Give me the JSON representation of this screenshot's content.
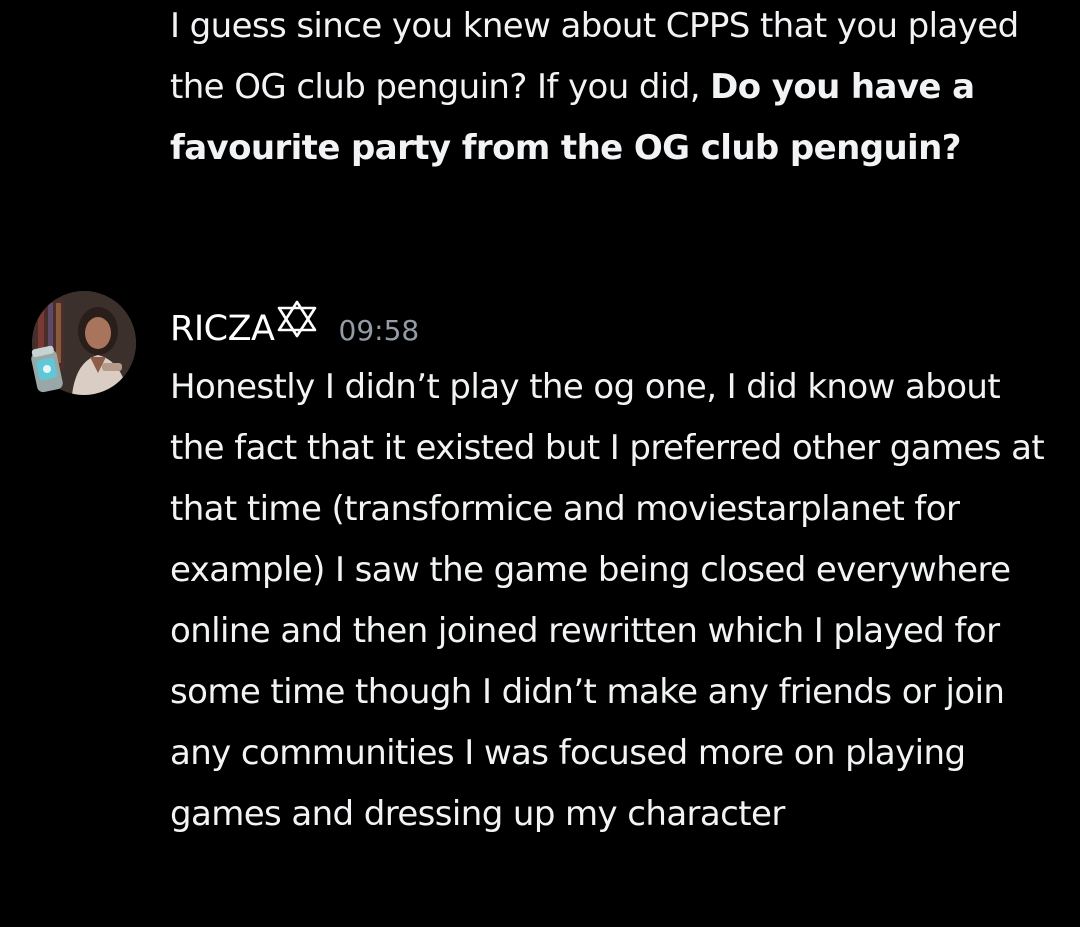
{
  "previous_message": {
    "text_plain": "I guess since you knew about CPPS that you played the OG club penguin? If you did, ",
    "text_bold": "Do you have a favourite party from the OG club penguin?"
  },
  "message": {
    "author": "RICZA",
    "author_icon": "pentagram-star-icon",
    "timestamp": "09:58",
    "avatar_icon": "user-avatar",
    "content": "Honestly I didn’t play the og one, I did know about the fact that it existed but I preferred other games at that time (transformice and moviestarplanet for example) I saw the game being closed everywhere online and then joined rewritten which I played for some time though I didn’t make any friends or join any communities I was focused more on playing games and dressing up my character"
  },
  "colors": {
    "background": "#000000",
    "text": "#f2f3f5",
    "timestamp": "#949ba4"
  }
}
